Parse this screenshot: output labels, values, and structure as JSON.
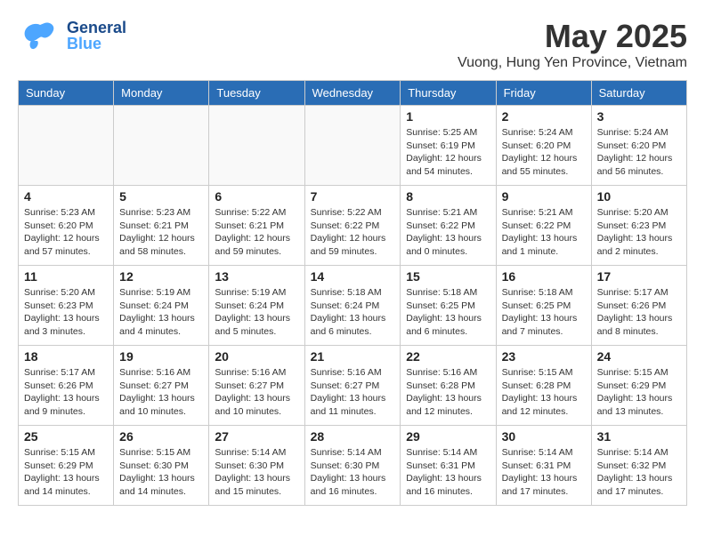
{
  "header": {
    "logo_general": "General",
    "logo_blue": "Blue",
    "month_title": "May 2025",
    "subtitle": "Vuong, Hung Yen Province, Vietnam"
  },
  "weekdays": [
    "Sunday",
    "Monday",
    "Tuesday",
    "Wednesday",
    "Thursday",
    "Friday",
    "Saturday"
  ],
  "weeks": [
    [
      {
        "day": "",
        "info": ""
      },
      {
        "day": "",
        "info": ""
      },
      {
        "day": "",
        "info": ""
      },
      {
        "day": "",
        "info": ""
      },
      {
        "day": "1",
        "info": "Sunrise: 5:25 AM\nSunset: 6:19 PM\nDaylight: 12 hours\nand 54 minutes."
      },
      {
        "day": "2",
        "info": "Sunrise: 5:24 AM\nSunset: 6:20 PM\nDaylight: 12 hours\nand 55 minutes."
      },
      {
        "day": "3",
        "info": "Sunrise: 5:24 AM\nSunset: 6:20 PM\nDaylight: 12 hours\nand 56 minutes."
      }
    ],
    [
      {
        "day": "4",
        "info": "Sunrise: 5:23 AM\nSunset: 6:20 PM\nDaylight: 12 hours\nand 57 minutes."
      },
      {
        "day": "5",
        "info": "Sunrise: 5:23 AM\nSunset: 6:21 PM\nDaylight: 12 hours\nand 58 minutes."
      },
      {
        "day": "6",
        "info": "Sunrise: 5:22 AM\nSunset: 6:21 PM\nDaylight: 12 hours\nand 59 minutes."
      },
      {
        "day": "7",
        "info": "Sunrise: 5:22 AM\nSunset: 6:22 PM\nDaylight: 12 hours\nand 59 minutes."
      },
      {
        "day": "8",
        "info": "Sunrise: 5:21 AM\nSunset: 6:22 PM\nDaylight: 13 hours\nand 0 minutes."
      },
      {
        "day": "9",
        "info": "Sunrise: 5:21 AM\nSunset: 6:22 PM\nDaylight: 13 hours\nand 1 minute."
      },
      {
        "day": "10",
        "info": "Sunrise: 5:20 AM\nSunset: 6:23 PM\nDaylight: 13 hours\nand 2 minutes."
      }
    ],
    [
      {
        "day": "11",
        "info": "Sunrise: 5:20 AM\nSunset: 6:23 PM\nDaylight: 13 hours\nand 3 minutes."
      },
      {
        "day": "12",
        "info": "Sunrise: 5:19 AM\nSunset: 6:24 PM\nDaylight: 13 hours\nand 4 minutes."
      },
      {
        "day": "13",
        "info": "Sunrise: 5:19 AM\nSunset: 6:24 PM\nDaylight: 13 hours\nand 5 minutes."
      },
      {
        "day": "14",
        "info": "Sunrise: 5:18 AM\nSunset: 6:24 PM\nDaylight: 13 hours\nand 6 minutes."
      },
      {
        "day": "15",
        "info": "Sunrise: 5:18 AM\nSunset: 6:25 PM\nDaylight: 13 hours\nand 6 minutes."
      },
      {
        "day": "16",
        "info": "Sunrise: 5:18 AM\nSunset: 6:25 PM\nDaylight: 13 hours\nand 7 minutes."
      },
      {
        "day": "17",
        "info": "Sunrise: 5:17 AM\nSunset: 6:26 PM\nDaylight: 13 hours\nand 8 minutes."
      }
    ],
    [
      {
        "day": "18",
        "info": "Sunrise: 5:17 AM\nSunset: 6:26 PM\nDaylight: 13 hours\nand 9 minutes."
      },
      {
        "day": "19",
        "info": "Sunrise: 5:16 AM\nSunset: 6:27 PM\nDaylight: 13 hours\nand 10 minutes."
      },
      {
        "day": "20",
        "info": "Sunrise: 5:16 AM\nSunset: 6:27 PM\nDaylight: 13 hours\nand 10 minutes."
      },
      {
        "day": "21",
        "info": "Sunrise: 5:16 AM\nSunset: 6:27 PM\nDaylight: 13 hours\nand 11 minutes."
      },
      {
        "day": "22",
        "info": "Sunrise: 5:16 AM\nSunset: 6:28 PM\nDaylight: 13 hours\nand 12 minutes."
      },
      {
        "day": "23",
        "info": "Sunrise: 5:15 AM\nSunset: 6:28 PM\nDaylight: 13 hours\nand 12 minutes."
      },
      {
        "day": "24",
        "info": "Sunrise: 5:15 AM\nSunset: 6:29 PM\nDaylight: 13 hours\nand 13 minutes."
      }
    ],
    [
      {
        "day": "25",
        "info": "Sunrise: 5:15 AM\nSunset: 6:29 PM\nDaylight: 13 hours\nand 14 minutes."
      },
      {
        "day": "26",
        "info": "Sunrise: 5:15 AM\nSunset: 6:30 PM\nDaylight: 13 hours\nand 14 minutes."
      },
      {
        "day": "27",
        "info": "Sunrise: 5:14 AM\nSunset: 6:30 PM\nDaylight: 13 hours\nand 15 minutes."
      },
      {
        "day": "28",
        "info": "Sunrise: 5:14 AM\nSunset: 6:30 PM\nDaylight: 13 hours\nand 16 minutes."
      },
      {
        "day": "29",
        "info": "Sunrise: 5:14 AM\nSunset: 6:31 PM\nDaylight: 13 hours\nand 16 minutes."
      },
      {
        "day": "30",
        "info": "Sunrise: 5:14 AM\nSunset: 6:31 PM\nDaylight: 13 hours\nand 17 minutes."
      },
      {
        "day": "31",
        "info": "Sunrise: 5:14 AM\nSunset: 6:32 PM\nDaylight: 13 hours\nand 17 minutes."
      }
    ]
  ]
}
